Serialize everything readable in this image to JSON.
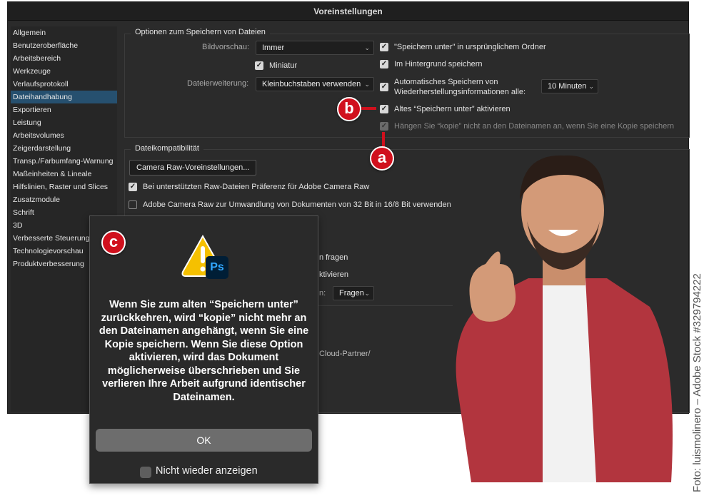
{
  "window": {
    "title": "Voreinstellungen"
  },
  "sidebar": {
    "items": [
      {
        "label": "Allgemein"
      },
      {
        "label": "Benutzeroberfläche"
      },
      {
        "label": "Arbeitsbereich"
      },
      {
        "label": "Werkzeuge"
      },
      {
        "label": "Verlaufsprotokoll"
      },
      {
        "label": "Dateihandhabung",
        "selected": true
      },
      {
        "label": "Exportieren"
      },
      {
        "label": "Leistung"
      },
      {
        "label": "Arbeitsvolumes"
      },
      {
        "label": "Zeigerdarstellung"
      },
      {
        "label": "Transp./Farbumfang-Warnung"
      },
      {
        "label": "Maßeinheiten & Lineale"
      },
      {
        "label": "Hilfslinien, Raster und Slices"
      },
      {
        "label": "Zusatzmodule"
      },
      {
        "label": "Schrift"
      },
      {
        "label": "3D"
      },
      {
        "label": "Verbesserte Steuerung"
      },
      {
        "label": "Technologievorschau"
      },
      {
        "label": "Produktverbesserung"
      }
    ]
  },
  "save_options": {
    "title": "Optionen zum Speichern von Dateien",
    "preview_label": "Bildvorschau:",
    "preview_value": "Immer",
    "thumbnail_label": "Miniatur",
    "extension_label": "Dateierweiterung:",
    "extension_value": "Kleinbuchstaben verwenden",
    "save_as_original": "\"Speichern unter\" in ursprünglichem Ordner",
    "background_save": "Im Hintergrund speichern",
    "autosave_line1": "Automatisches Speichern von",
    "autosave_line2": "Wiederherstellungsinformationen alle:",
    "autosave_value": "10 Minuten",
    "legacy_save_as": "Altes “Speichern unter” aktivieren",
    "no_copy_suffix": "Hängen Sie “kopie” nicht an den Dateinamen an, wenn Sie eine Kopie speichern"
  },
  "compat": {
    "title": "Dateikompatibilität",
    "camera_raw_button": "Camera Raw-Voreinstellungen...",
    "prefer_acr": "Bei unterstützten Raw-Dateien Präferenz für Adobe Camera Raw",
    "acr_convert": "Adobe Camera Raw zur Umwandlung von Dokumenten von 32 Bit in 16/8 Bit verwenden",
    "partial_ask": "n fragen",
    "partial_activate": "ktivieren",
    "partial_label": "n:",
    "ask_value": "Fragen",
    "partial_cloud": "Cloud-Partner/"
  },
  "markers": {
    "a": "a",
    "b": "b",
    "c": "c"
  },
  "dialog": {
    "badge": "Ps",
    "message": "Wenn Sie zum alten “Speichern unter” zurückkehren, wird “kopie” nicht mehr an den Dateinamen angehängt, wenn Sie eine Kopie speichern. Wenn Sie diese Option aktivieren, wird das Dokument möglicherweise überschrieben und Sie verlieren Ihre Arbeit aufgrund identischer Dateinamen.",
    "ok": "OK",
    "dont_show": "Nicht wieder anzeigen"
  },
  "credit": "Foto: luismolinero – Adobe Stock #329794222",
  "colors": {
    "marker": "#d0101d",
    "selected": "#26506f"
  }
}
